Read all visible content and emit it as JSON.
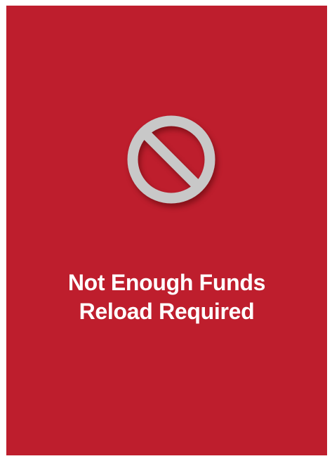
{
  "screen": {
    "background_color": "#be1e2d",
    "icon": {
      "name": "prohibited-icon",
      "color": "#c8c8c8"
    },
    "message": {
      "line1": "Not Enough Funds",
      "line2": "Reload Required"
    }
  }
}
